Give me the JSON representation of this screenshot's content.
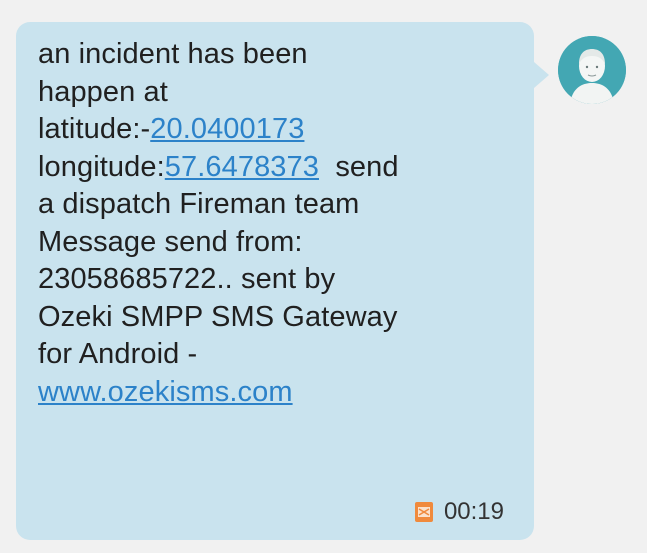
{
  "message": {
    "lines": [
      {
        "before": "an incident has been",
        "link": "",
        "after": ""
      },
      {
        "before": "happen at",
        "link": "",
        "after": ""
      },
      {
        "before": "latitude:-",
        "link": "20.0400173",
        "after": ""
      },
      {
        "before": "longitude:",
        "link": "57.6478373",
        "after": "  send"
      },
      {
        "before": "a dispatch Fireman team",
        "link": "",
        "after": ""
      },
      {
        "before": "Message send from:",
        "link": "",
        "after": ""
      },
      {
        "before": "23058685722.. sent by",
        "link": "",
        "after": ""
      },
      {
        "before": "Ozeki SMPP SMS Gateway",
        "link": "",
        "after": ""
      },
      {
        "before": "for Android -",
        "link": "",
        "after": ""
      },
      {
        "before": "",
        "link": "www.ozekisms.com",
        "after": ""
      }
    ],
    "timestamp": "00:19",
    "status_icon": "sms-icon"
  },
  "avatar": {
    "icon": "person-avatar-icon"
  },
  "colors": {
    "bubble": "#c9e3ee",
    "background": "#f1f1f1",
    "link": "#2c82c9",
    "avatar": "#43a7b3",
    "text": "#202020"
  }
}
